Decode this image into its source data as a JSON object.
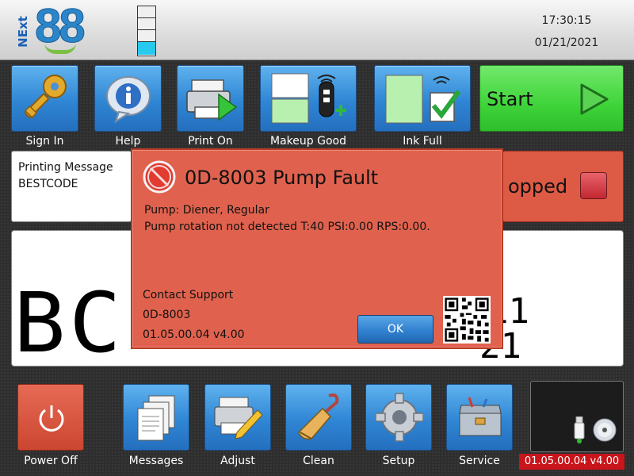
{
  "header": {
    "logo_prefix": "NExt",
    "logo_number": "88",
    "time": "17:30:15",
    "date": "01/21/2021",
    "ink_level_segments": 4,
    "ink_level_filled": 1
  },
  "toolbar": {
    "items": [
      {
        "label": "Sign In",
        "icon": "key-icon"
      },
      {
        "label": "Help",
        "icon": "info-icon"
      },
      {
        "label": "Print On",
        "icon": "printer-icon"
      },
      {
        "label": "Makeup Good",
        "icon": "makeup-level-icon"
      },
      {
        "label": "Ink Full",
        "icon": "ink-level-icon"
      }
    ],
    "start_label": "Start"
  },
  "message_panel": {
    "title": "Printing Message",
    "name": "BESTCODE"
  },
  "status": {
    "text": "opped",
    "color": "#dd5a45"
  },
  "preview": {
    "line1": "BC-",
    "line2a": "11",
    "line2b": "21"
  },
  "dialog": {
    "title": "0D-8003 Pump Fault",
    "line1": "Pump: Diener, Regular",
    "line2": "Pump rotation not detected T:40 PSI:0.00 RPS:0.00.",
    "contact": "Contact Support",
    "code": "0D-8003",
    "version": "01.05.00.04 v4.00",
    "ok_label": "OK",
    "color": "#e0624e"
  },
  "bottom": {
    "power_label": "Power Off",
    "items": [
      {
        "label": "Messages",
        "icon": "messages-icon"
      },
      {
        "label": "Adjust",
        "icon": "adjust-icon"
      },
      {
        "label": "Clean",
        "icon": "brush-icon"
      },
      {
        "label": "Setup",
        "icon": "gear-icon"
      },
      {
        "label": "Service",
        "icon": "toolbox-icon"
      }
    ],
    "version_badge": "01.05.00.04 v4.00"
  }
}
